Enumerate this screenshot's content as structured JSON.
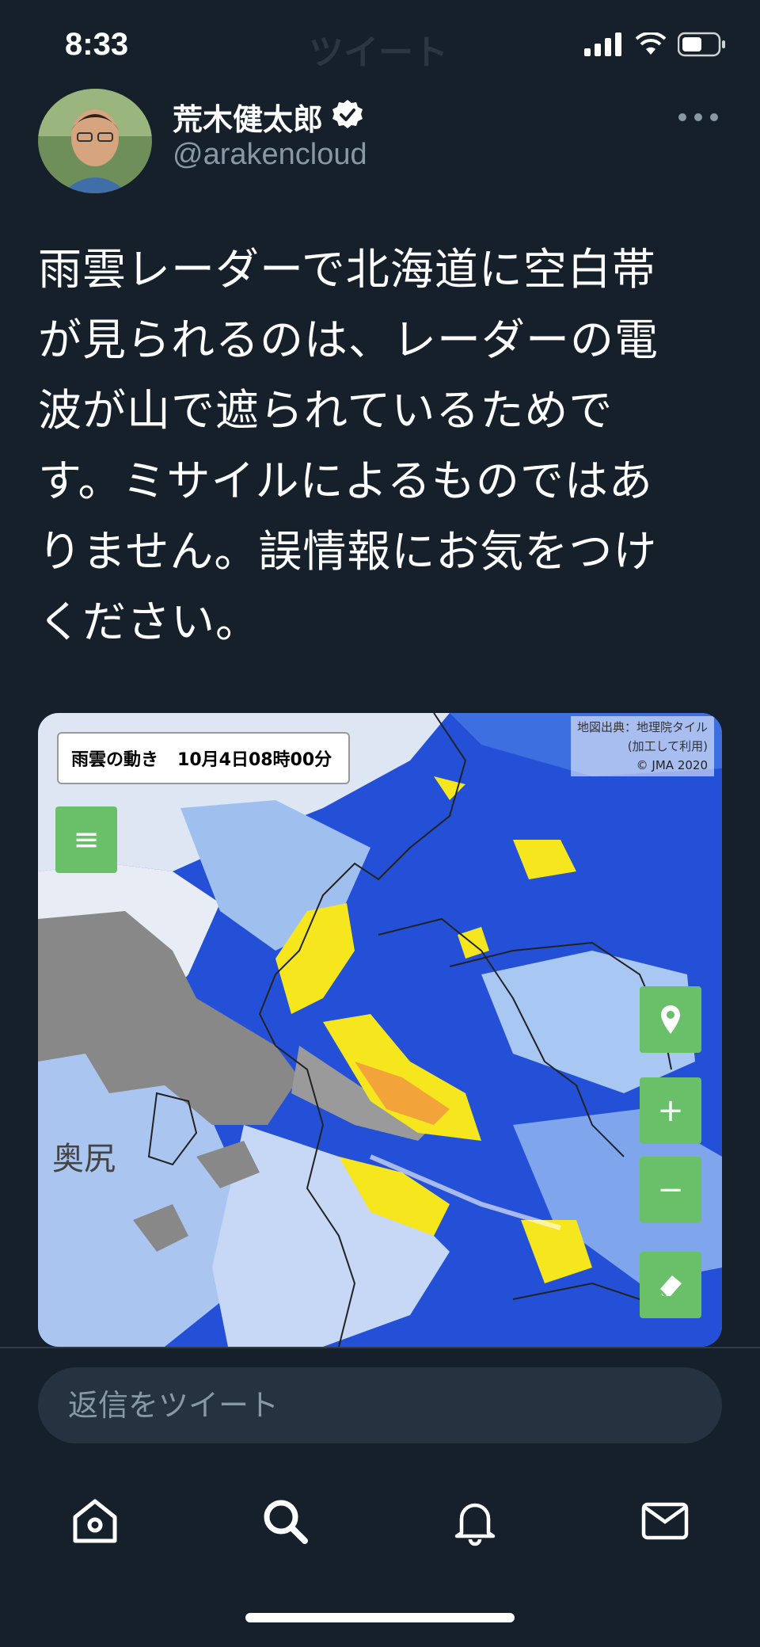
{
  "status_bar": {
    "time": "8:33"
  },
  "header": {
    "title": "ツイート"
  },
  "tweet": {
    "author_name": "荒木健太郎",
    "handle": "@arakencloud",
    "text_lines": [
      "雨雲レーダーで北海道に空白帯",
      "が見られるのは、レーダーの電",
      "波が山で遮られているためで",
      "す。ミサイルによるものではあ",
      "りません。誤情報にお気をつけ",
      "ください。"
    ]
  },
  "map": {
    "title": "雨雲の動き",
    "time": "10月4日08時00分",
    "credit_line1": "地図出典：地理院タイル",
    "credit_line2": "(加工して利用)",
    "credit_line3": "© JMA 2020",
    "place_label": "奥尻",
    "zoom_in_label": "+",
    "zoom_out_label": "−",
    "menu_label": "≡"
  },
  "reply": {
    "placeholder": "返信をツイート"
  },
  "tabs": [
    "home-icon",
    "search-icon",
    "bell-icon",
    "mail-icon"
  ]
}
